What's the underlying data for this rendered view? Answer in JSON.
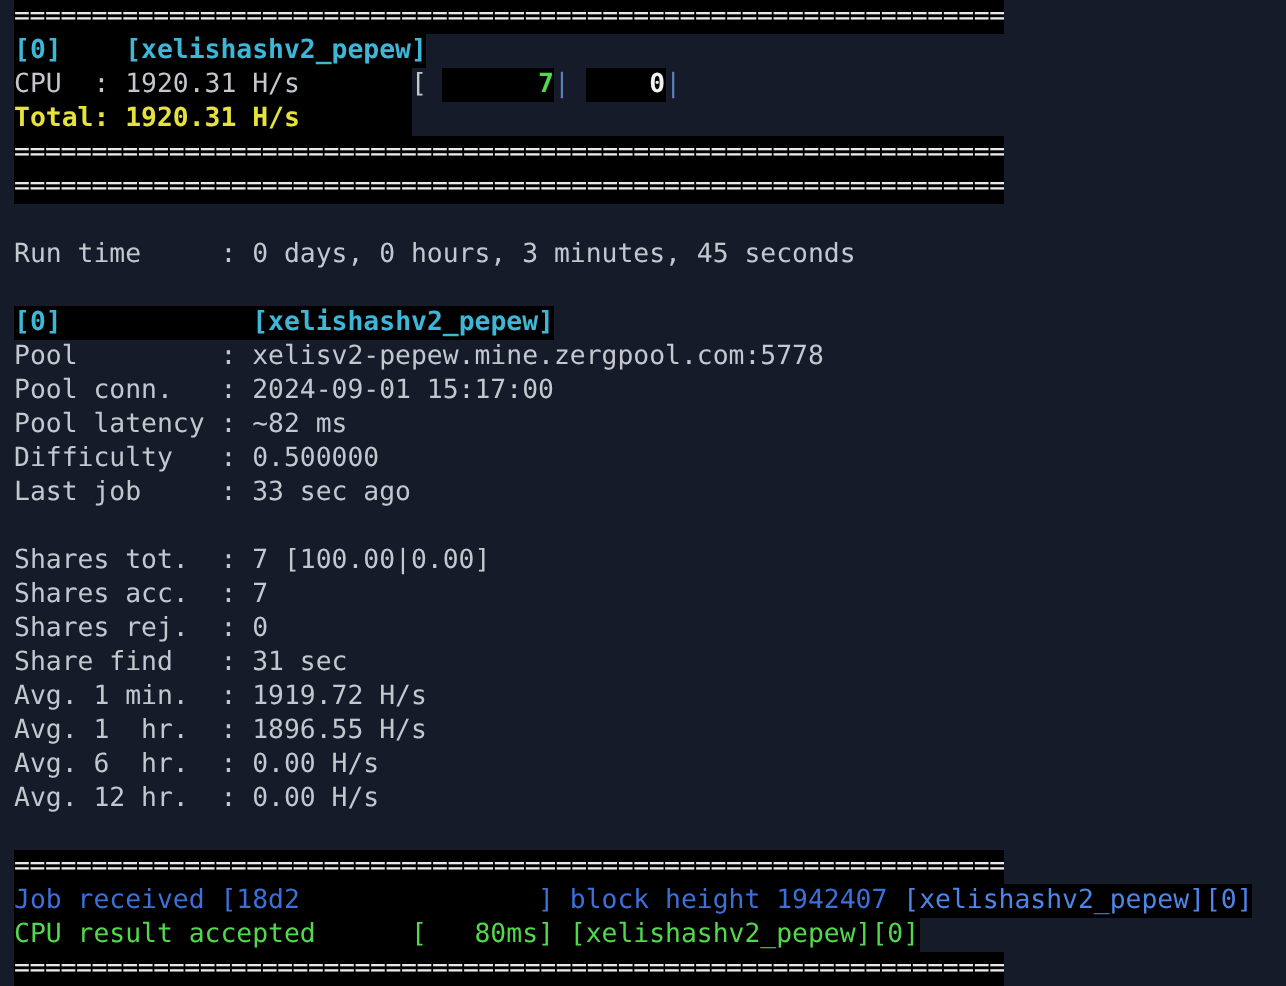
{
  "terminal": {
    "lines": [
      {
        "kind": "separator",
        "text": "================================================================"
      },
      {
        "kind": "text",
        "segments": [
          {
            "text": "[0]    [xelishashv2_pepew]",
            "color": "#3db7d8",
            "bold": true,
            "highlight": true
          }
        ]
      },
      {
        "kind": "text",
        "segments": [
          {
            "text": "CPU  : 1920.31 H/s       ",
            "color": "#c3c7ce",
            "bold": false,
            "highlight": true
          },
          {
            "text": "[ ",
            "color": "#c3c7ce",
            "bold": false,
            "highlight": false
          },
          {
            "text": "      7",
            "color": "#52d84c",
            "bold": true,
            "highlight": true
          },
          {
            "text": "| ",
            "color": "#5b7fb8",
            "bold": false,
            "highlight": false
          },
          {
            "text": "    0",
            "color": "#f2f2f2",
            "bold": true,
            "highlight": true
          },
          {
            "text": "|",
            "color": "#5b7fb8",
            "bold": false,
            "highlight": false
          }
        ]
      },
      {
        "kind": "text",
        "segments": [
          {
            "text": "Total: 1920.31 H/s       ",
            "color": "#e6e23c",
            "bold": true,
            "highlight": true
          }
        ]
      },
      {
        "kind": "separator",
        "text": "================================================================"
      },
      {
        "kind": "separator",
        "text": "================================================================"
      },
      {
        "kind": "blank"
      },
      {
        "kind": "text",
        "segments": [
          {
            "text": "Run time     : 0 days, 0 hours, 3 minutes, 45 seconds",
            "color": "#c3c7ce",
            "bold": false,
            "highlight": false
          }
        ]
      },
      {
        "kind": "blank"
      },
      {
        "kind": "text",
        "segments": [
          {
            "text": "[0]            ",
            "color": "#3db7d8",
            "bold": true,
            "highlight": true
          },
          {
            "text": "[xelishashv2_pepew]",
            "color": "#3db7d8",
            "bold": true,
            "highlight": true
          }
        ]
      },
      {
        "kind": "text",
        "segments": [
          {
            "text": "Pool         : xelisv2-pepew.mine.zergpool.com:5778",
            "color": "#c3c7ce",
            "bold": false,
            "highlight": false
          }
        ]
      },
      {
        "kind": "text",
        "segments": [
          {
            "text": "Pool conn.   : 2024-09-01 15:17:00",
            "color": "#c3c7ce",
            "bold": false,
            "highlight": false
          }
        ]
      },
      {
        "kind": "text",
        "segments": [
          {
            "text": "Pool latency : ~82 ms",
            "color": "#c3c7ce",
            "bold": false,
            "highlight": false
          }
        ]
      },
      {
        "kind": "text",
        "segments": [
          {
            "text": "Difficulty   : 0.500000",
            "color": "#c3c7ce",
            "bold": false,
            "highlight": false
          }
        ]
      },
      {
        "kind": "text",
        "segments": [
          {
            "text": "Last job     : 33 sec ago",
            "color": "#c3c7ce",
            "bold": false,
            "highlight": false
          }
        ]
      },
      {
        "kind": "blank"
      },
      {
        "kind": "text",
        "segments": [
          {
            "text": "Shares tot.  : 7 [100.00|0.00]",
            "color": "#c3c7ce",
            "bold": false,
            "highlight": false
          }
        ]
      },
      {
        "kind": "text",
        "segments": [
          {
            "text": "Shares acc.  : 7",
            "color": "#c3c7ce",
            "bold": false,
            "highlight": false
          }
        ]
      },
      {
        "kind": "text",
        "segments": [
          {
            "text": "Shares rej.  : 0",
            "color": "#c3c7ce",
            "bold": false,
            "highlight": false
          }
        ]
      },
      {
        "kind": "text",
        "segments": [
          {
            "text": "Share find   : 31 sec",
            "color": "#c3c7ce",
            "bold": false,
            "highlight": false
          }
        ]
      },
      {
        "kind": "text",
        "segments": [
          {
            "text": "Avg. 1 min.  : 1919.72 H/s",
            "color": "#c3c7ce",
            "bold": false,
            "highlight": false
          }
        ]
      },
      {
        "kind": "text",
        "segments": [
          {
            "text": "Avg. 1  hr.  : 1896.55 H/s",
            "color": "#c3c7ce",
            "bold": false,
            "highlight": false
          }
        ]
      },
      {
        "kind": "text",
        "segments": [
          {
            "text": "Avg. 6  hr.  : 0.00 H/s",
            "color": "#c3c7ce",
            "bold": false,
            "highlight": false
          }
        ]
      },
      {
        "kind": "text",
        "segments": [
          {
            "text": "Avg. 12 hr.  : 0.00 H/s",
            "color": "#c3c7ce",
            "bold": false,
            "highlight": false
          }
        ]
      },
      {
        "kind": "blank"
      },
      {
        "kind": "separator",
        "text": "================================================================"
      },
      {
        "kind": "text",
        "segments": [
          {
            "text": "Job received [18d2               ] block height 1942407 ",
            "color": "#3c6fd9",
            "bold": false,
            "highlight": true
          },
          {
            "text": "[xelishashv2_pepew][0]",
            "color": "#4d86ea",
            "bold": false,
            "highlight": true
          }
        ]
      },
      {
        "kind": "text",
        "segments": [
          {
            "text": "CPU result accepted      [   80ms] [xelishashv2_pepew][0]",
            "color": "#52d84c",
            "bold": false,
            "highlight": true
          }
        ]
      },
      {
        "kind": "separator",
        "text": "================================================================"
      }
    ]
  }
}
